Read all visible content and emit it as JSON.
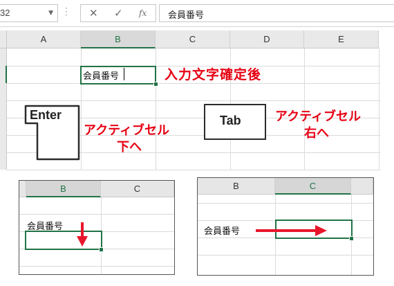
{
  "formula_bar": {
    "name_box": "32",
    "cancel_icon": "✕",
    "enter_icon": "✓",
    "fx_icon": "fx",
    "content": "会員番号"
  },
  "grid": {
    "columns": [
      "A",
      "B",
      "C",
      "D",
      "E"
    ],
    "selected_column": "B",
    "cell_value": "会員番号"
  },
  "annotations": {
    "title": "入力文字確定後",
    "enter_key": "Enter",
    "tab_key": "Tab",
    "enter_result_line1": "アクティブセル",
    "enter_result_line2": "下へ",
    "tab_result_line1": "アクティブセル",
    "tab_result_line2": "右へ"
  },
  "panel_enter": {
    "columns": [
      "B",
      "C"
    ],
    "selected_column": "B",
    "cell_value": "会員番号"
  },
  "panel_tab": {
    "columns": [
      "B",
      "C"
    ],
    "selected_column": "C",
    "cell_value": "会員番号"
  },
  "colors": {
    "excel_green": "#217346",
    "annotation_red": "#e60012",
    "arrow_red": "#e8162b"
  }
}
